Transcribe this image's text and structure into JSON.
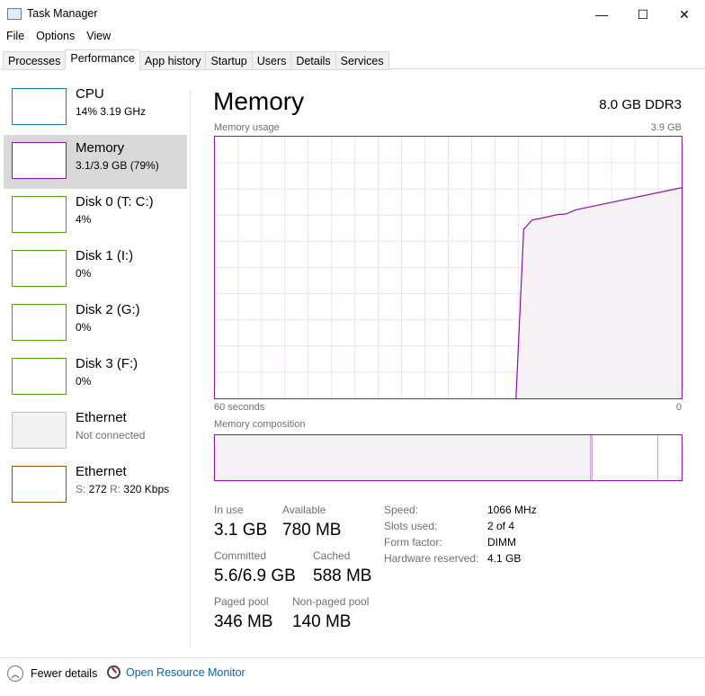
{
  "window": {
    "title": "Task Manager",
    "minimize": "—",
    "maximize": "☐",
    "close": "✕"
  },
  "menu": [
    "File",
    "Options",
    "View"
  ],
  "tabs": [
    "Processes",
    "Performance",
    "App history",
    "Startup",
    "Users",
    "Details",
    "Services"
  ],
  "sidebar": [
    {
      "name": "CPU",
      "value": "14% 3.19 GHz",
      "color": "#117dbb"
    },
    {
      "name": "Memory",
      "value": "3.1/3.9 GB (79%)",
      "color": "#8b12ae"
    },
    {
      "name": "Disk 0 (T: C:)",
      "value": "4%",
      "color": "#4da60c"
    },
    {
      "name": "Disk 1 (I:)",
      "value": "0%",
      "color": "#4da60c"
    },
    {
      "name": "Disk 2 (G:)",
      "value": "0%",
      "color": "#4da60c"
    },
    {
      "name": "Disk 3 (F:)",
      "value": "0%",
      "color": "#4da60c"
    },
    {
      "name": "Ethernet",
      "value": "Not connected",
      "color": "#c0c0c0"
    },
    {
      "name": "Ethernet",
      "value_s_label": "S:",
      "value_s": "272",
      "value_r_label": "R:",
      "value_r": "320 Kbps",
      "color": "#a74f01"
    }
  ],
  "main": {
    "title": "Memory",
    "spec": "8.0 GB DDR3",
    "usage_label": "Memory usage",
    "usage_max": "3.9 GB",
    "time_left": "60 seconds",
    "time_right": "0",
    "composition_label": "Memory composition"
  },
  "stats": {
    "in_use_label": "In use",
    "in_use": "3.1 GB",
    "available_label": "Available",
    "available": "780 MB",
    "committed_label": "Committed",
    "committed": "5.6/6.9 GB",
    "cached_label": "Cached",
    "cached": "588 MB",
    "paged_label": "Paged pool",
    "paged": "346 MB",
    "nonpaged_label": "Non-paged pool",
    "nonpaged": "140 MB"
  },
  "hw": [
    {
      "k": "Speed:",
      "v": "1066 MHz"
    },
    {
      "k": "Slots used:",
      "v": "2 of 4"
    },
    {
      "k": "Form factor:",
      "v": "DIMM"
    },
    {
      "k": "Hardware reserved:",
      "v": "4.1 GB"
    }
  ],
  "footer": {
    "fewer": "Fewer details",
    "monitor": "Open Resource Monitor"
  },
  "chart_data": {
    "type": "area",
    "title": "Memory usage",
    "xlabel": "seconds ago",
    "ylabel": "GB",
    "xlim": [
      60,
      0
    ],
    "ylim": [
      0,
      3.9
    ],
    "x": [
      21.3,
      20.3,
      19.2,
      18.2,
      17.1,
      15.9,
      14.8,
      13.6,
      0
    ],
    "values": [
      0,
      2.52,
      2.66,
      2.68,
      2.71,
      2.74,
      2.75,
      2.81,
      3.14
    ],
    "composition_fractions": {
      "in_use": 0.806,
      "modified": 0.004,
      "standby": 0.14,
      "free": 0.05
    }
  }
}
